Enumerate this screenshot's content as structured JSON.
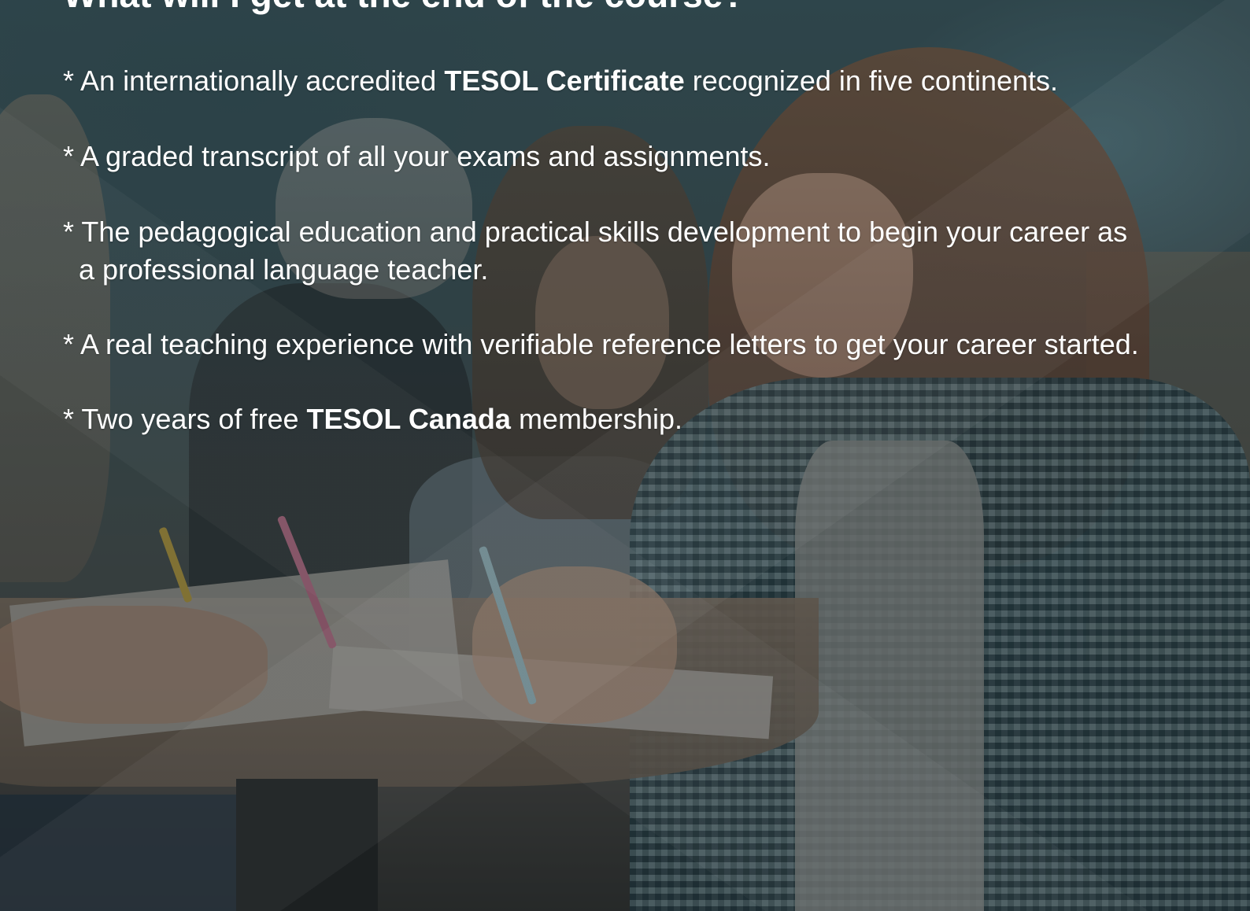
{
  "heading": "What will I get at the end of the course?",
  "benefits": [
    {
      "bullet": "*",
      "before": "An internationally accredited",
      "bold": "TESOL Certificate",
      "after": "recognized in five continents."
    },
    {
      "bullet": "*",
      "text": "A graded transcript of all your exams and assignments."
    },
    {
      "bullet": "*",
      "line1": "The pedagogical education and practical skills development to begin your career as",
      "line2": "a professional language teacher."
    },
    {
      "bullet": "*",
      "text": "A real teaching experience with verifiable reference letters to get your career started."
    },
    {
      "bullet": "*",
      "before": "Two years of free",
      "bold": "TESOL Canada",
      "after": "membership."
    }
  ],
  "colors": {
    "text": "#ffffff",
    "overlay": "#1e282c"
  }
}
